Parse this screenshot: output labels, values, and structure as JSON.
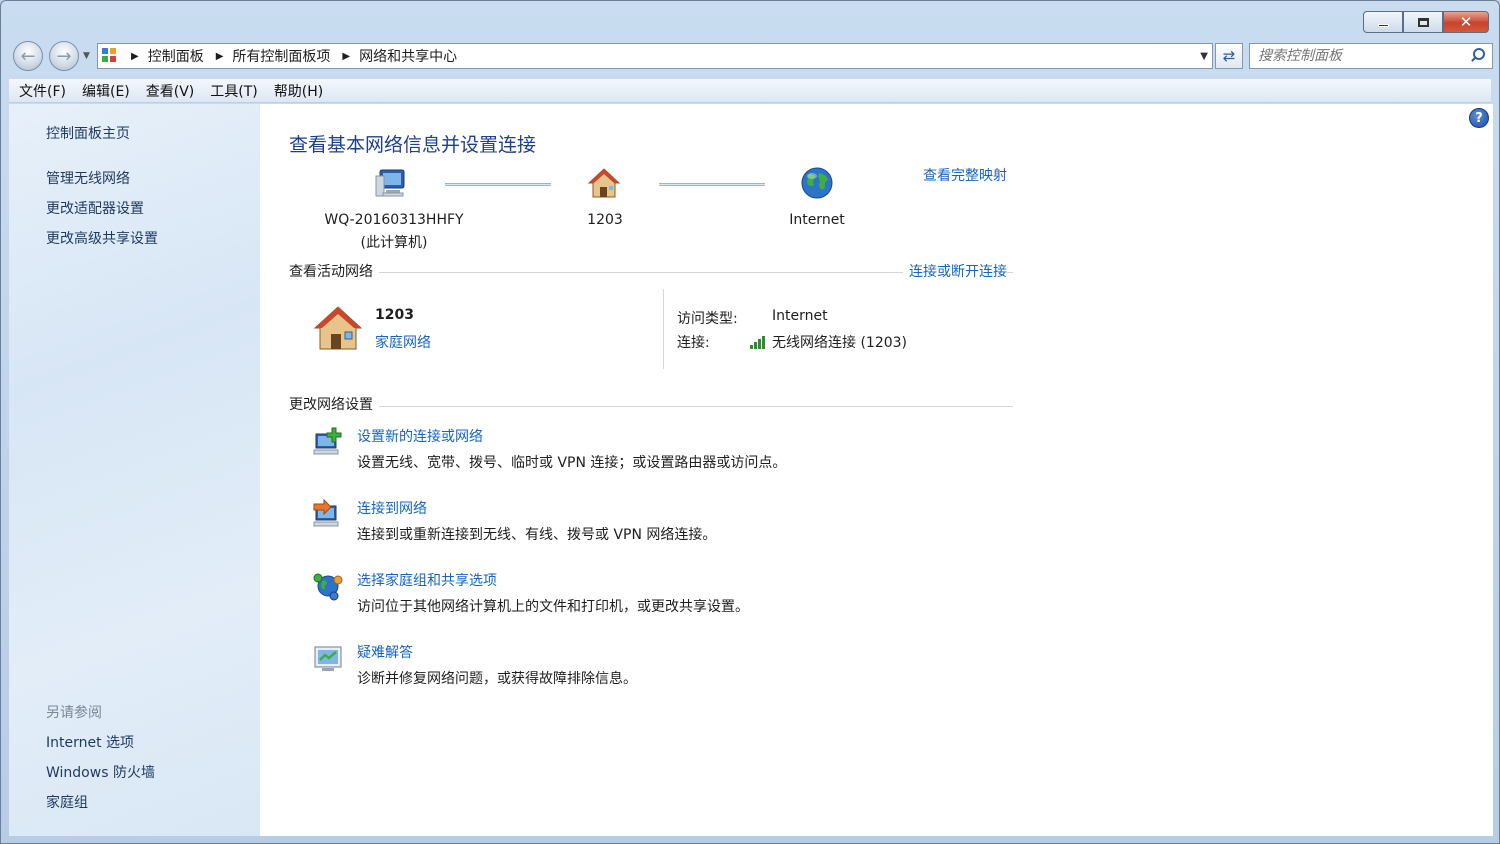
{
  "window": {
    "caption": {
      "minimize": "—",
      "maximize": "□",
      "close": "✕"
    }
  },
  "nav": {
    "breadcrumbs": [
      "控制面板",
      "所有控制面板项",
      "网络和共享中心"
    ],
    "search_placeholder": "搜索控制面板"
  },
  "menu": [
    "文件(F)",
    "编辑(E)",
    "查看(V)",
    "工具(T)",
    "帮助(H)"
  ],
  "sidebar": {
    "links": [
      "控制面板主页",
      "管理无线网络",
      "更改适配器设置",
      "更改高级共享设置"
    ],
    "see_also_heading": "另请参阅",
    "see_also": [
      "Internet 选项",
      "Windows 防火墙",
      "家庭组"
    ]
  },
  "main": {
    "title": "查看基本网络信息并设置连接",
    "map_link": "查看完整映射",
    "nodes": {
      "computer_name": "WQ-20160313HHFY",
      "computer_sub": "(此计算机)",
      "network": "1203",
      "internet": "Internet"
    },
    "active_networks": {
      "heading": "查看活动网络",
      "connect_link": "连接或断开连接",
      "name": "1203",
      "type": "家庭网络",
      "access_type_label": "访问类型:",
      "access_type_value": "Internet",
      "connection_label": "连接:",
      "connection_value": "无线网络连接 (1203)"
    },
    "change_settings": {
      "heading": "更改网络设置",
      "tasks": [
        {
          "title": "设置新的连接或网络",
          "desc": "设置无线、宽带、拨号、临时或 VPN 连接；或设置路由器或访问点。"
        },
        {
          "title": "连接到网络",
          "desc": "连接到或重新连接到无线、有线、拨号或 VPN 网络连接。"
        },
        {
          "title": "选择家庭组和共享选项",
          "desc": "访问位于其他网络计算机上的文件和打印机，或更改共享设置。"
        },
        {
          "title": "疑难解答",
          "desc": "诊断并修复网络问题，或获得故障排除信息。"
        }
      ]
    }
  },
  "colors": {
    "link": "#1565c0",
    "title": "#1e3f8c",
    "sidebar_link": "#1e3a5f"
  },
  "icons": {
    "computer": "computer-icon",
    "home_network": "house-icon",
    "internet": "globe-icon",
    "help": "help-icon",
    "search": "search-icon",
    "signal": "wireless-signal-icon"
  }
}
